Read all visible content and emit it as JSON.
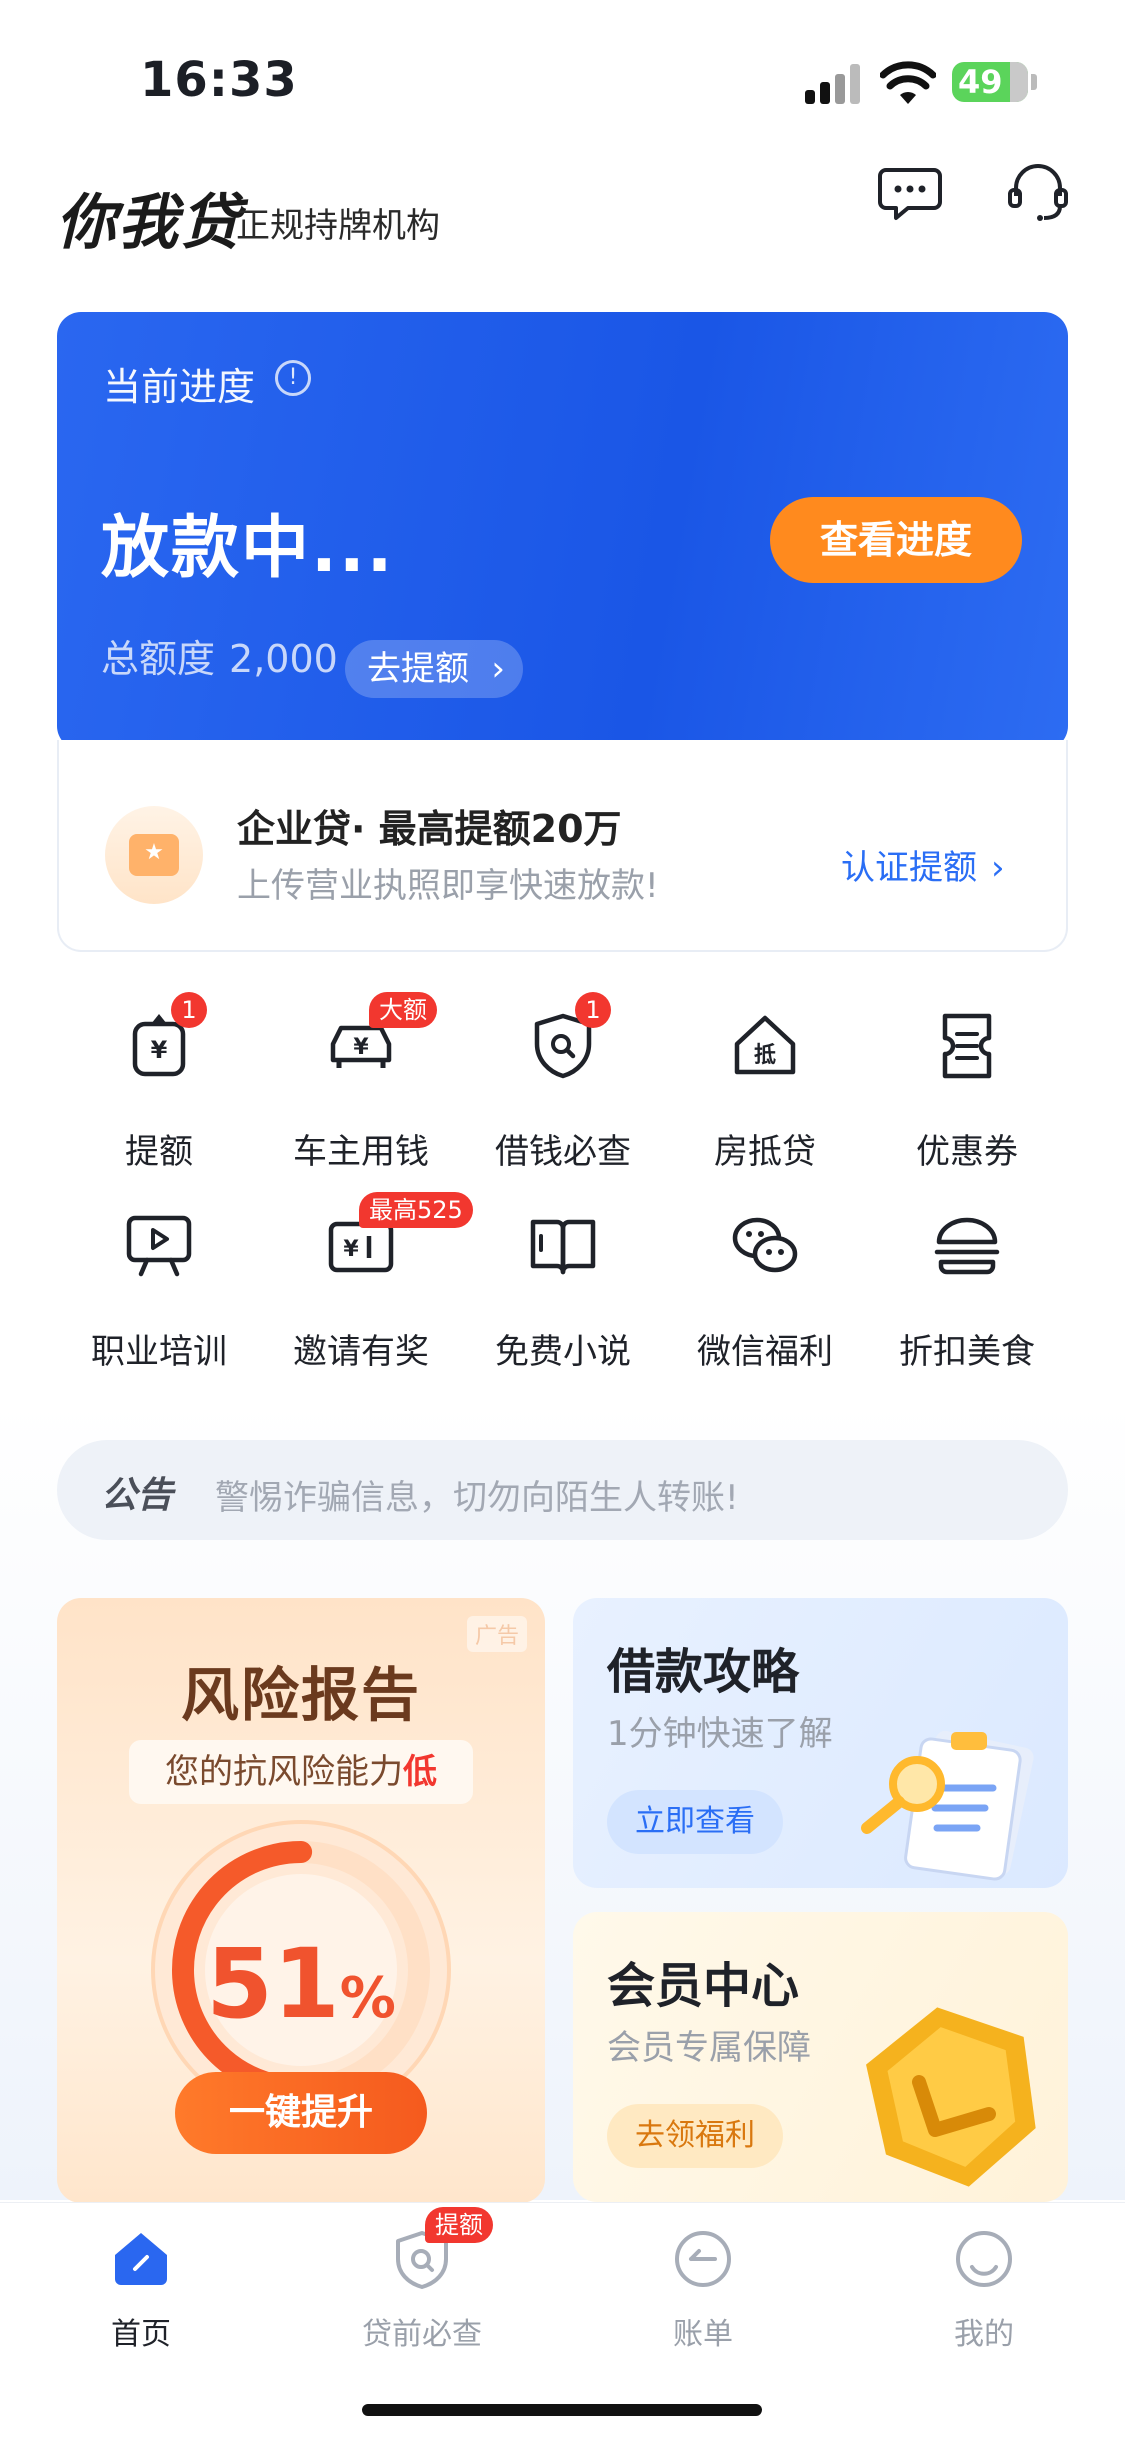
{
  "status_bar": {
    "time": "16:33",
    "battery": "49"
  },
  "header": {
    "logo": "你我贷",
    "slogan": "正规持牌机构"
  },
  "progress_card": {
    "title": "当前进度",
    "status": "放款中...",
    "view_button": "查看进度",
    "quota_label": "总额度",
    "quota_value": "2,000",
    "raise_button": "去提额"
  },
  "biz_card": {
    "title": "企业贷· 最高提额20万",
    "subtitle": "上传营业执照即享快速放款!",
    "link": "认证提额"
  },
  "grid": [
    {
      "label": "提额",
      "icon": "raise-quota-icon",
      "badge": "1"
    },
    {
      "label": "车主用钱",
      "icon": "car-loan-icon",
      "badge": "大额"
    },
    {
      "label": "借钱必查",
      "icon": "shield-search-icon",
      "badge": "1"
    },
    {
      "label": "房抵贷",
      "icon": "house-mortgage-icon",
      "badge": ""
    },
    {
      "label": "优惠券",
      "icon": "coupon-icon",
      "badge": ""
    },
    {
      "label": "职业培训",
      "icon": "training-icon",
      "badge": ""
    },
    {
      "label": "邀请有奖",
      "icon": "invite-reward-icon",
      "badge": "最高525"
    },
    {
      "label": "免费小说",
      "icon": "book-icon",
      "badge": ""
    },
    {
      "label": "微信福利",
      "icon": "wechat-icon",
      "badge": ""
    },
    {
      "label": "折扣美食",
      "icon": "burger-icon",
      "badge": ""
    }
  ],
  "notice": {
    "tag": "公告",
    "message": "警惕诈骗信息，切勿向陌生人转账!"
  },
  "risk_card": {
    "ad": "广告",
    "title": "风险报告",
    "subtitle_prefix": "您的抗风险能力",
    "subtitle_level": "低",
    "percent": "51",
    "percent_sign": "%",
    "gauge_fraction": 0.51,
    "button": "一键提升"
  },
  "guide_card": {
    "title": "借款攻略",
    "subtitle": "1分钟快速了解",
    "button": "立即查看"
  },
  "member_card": {
    "title": "会员中心",
    "subtitle": "会员专属保障",
    "button": "去领福利"
  },
  "tabs": [
    {
      "label": "首页",
      "icon": "home-icon",
      "active": true,
      "badge": ""
    },
    {
      "label": "贷前必查",
      "icon": "pre-loan-check-icon",
      "active": false,
      "badge": "提额"
    },
    {
      "label": "账单",
      "icon": "bill-icon",
      "active": false,
      "badge": ""
    },
    {
      "label": "我的",
      "icon": "profile-icon",
      "active": false,
      "badge": ""
    }
  ],
  "colors": {
    "accent": "#1a56e6",
    "orange": "#ff8a1e",
    "badge_red": "#f2372f"
  }
}
